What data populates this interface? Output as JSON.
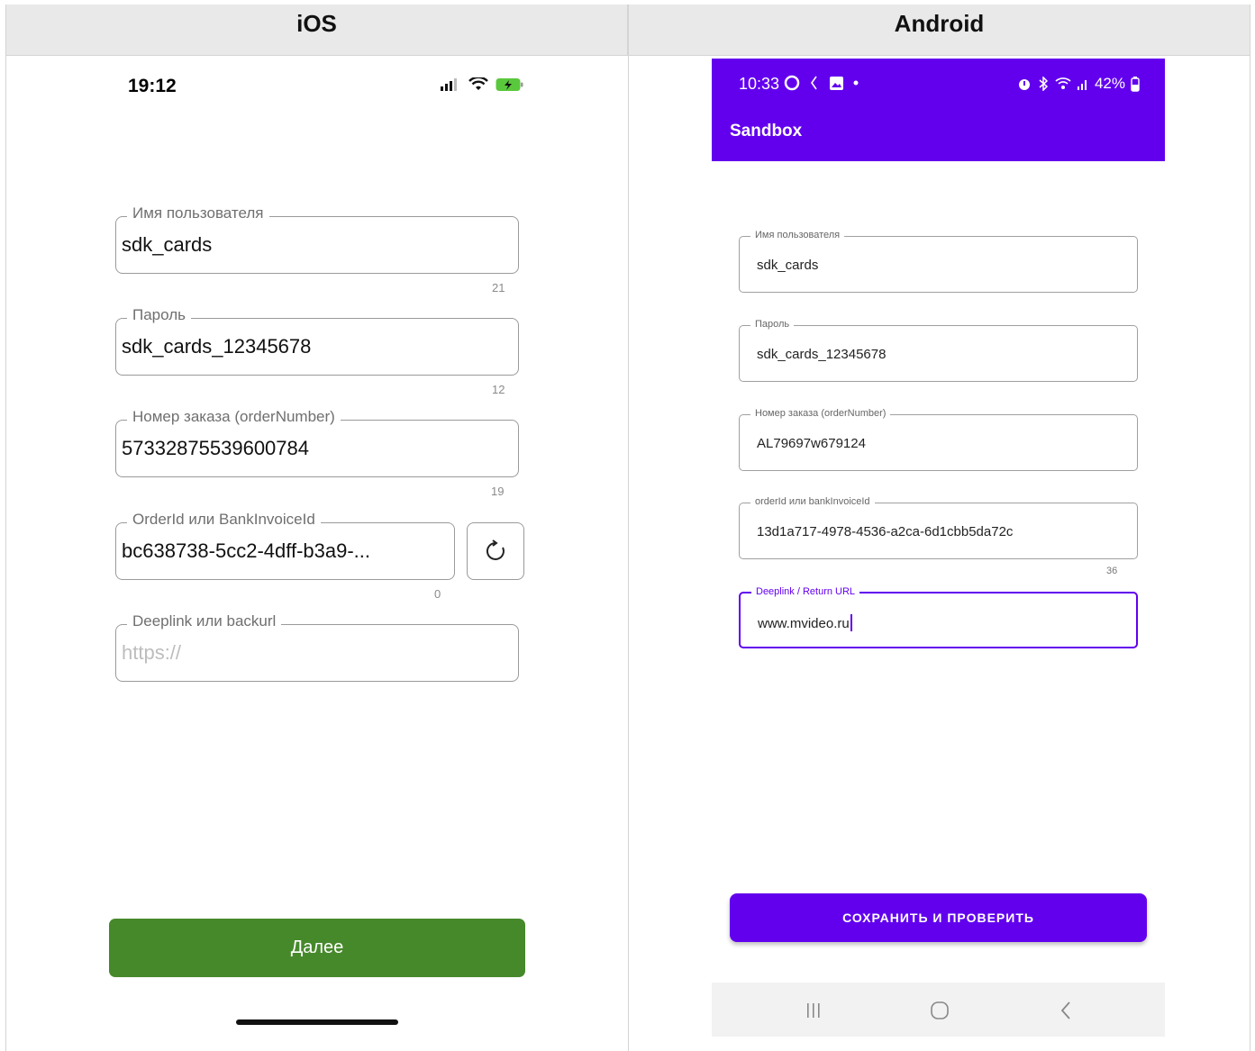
{
  "headers": {
    "ios": "iOS",
    "android": "Android"
  },
  "ios": {
    "status_time": "19:12",
    "fields": [
      {
        "label": "Имя пользователя",
        "value": "sdk_cards",
        "counter": "21"
      },
      {
        "label": "Пароль",
        "value": "sdk_cards_12345678",
        "counter": "12"
      },
      {
        "label": "Номер заказа (orderNumber)",
        "value": "57332875539600784",
        "counter": "19"
      },
      {
        "label": "OrderId или BankInvoiceId",
        "value": "bc638738-5cc2-4dff-b3a9-...",
        "counter": "0"
      },
      {
        "label": "Deeplink или backurl",
        "placeholder": "https://"
      }
    ],
    "next_button": "Далее",
    "icons": [
      "signal-icon",
      "wifi-icon",
      "battery-charging-icon",
      "refresh-icon"
    ]
  },
  "android": {
    "status_time": "10:33",
    "battery": "42%",
    "app_title": "Sandbox",
    "fields": [
      {
        "label": "Имя пользователя",
        "value": "sdk_cards"
      },
      {
        "label": "Пароль",
        "value": "sdk_cards_12345678"
      },
      {
        "label": "Номер заказа (orderNumber)",
        "value": "AL79697w679124"
      },
      {
        "label": "orderId или bankInvoiceId",
        "value": "13d1a717-4978-4536-a2ca-6d1cbb5da72c",
        "counter": "36"
      },
      {
        "label": "Deeplink / Return URL",
        "value": "www.mvideo.ru"
      }
    ],
    "save_button": "СОХРАНИТЬ И ПРОВЕРИТЬ",
    "accent_color": "#6200ee",
    "icons": [
      "circle-icon",
      "sync-icon",
      "image-icon",
      "alarm-icon",
      "bluetooth-icon",
      "wifi-icon",
      "signal-icon",
      "battery-icon",
      "recents-icon",
      "home-icon",
      "back-icon"
    ]
  },
  "ios_accent_color": "#46892b"
}
